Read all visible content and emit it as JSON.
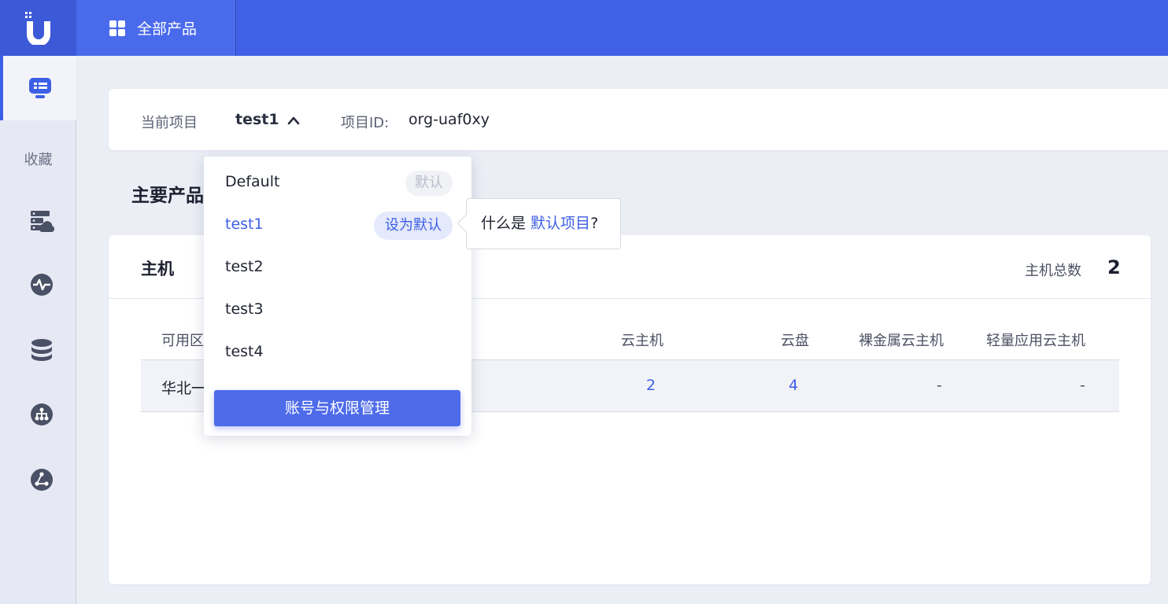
{
  "topbar": {
    "all_products_label": "全部产品"
  },
  "sidebar": {
    "favorites_label": "收藏",
    "items": [
      {
        "icon": "dashboard-icon"
      },
      {
        "icon": "cloud-server-icon"
      },
      {
        "icon": "monitoring-icon"
      },
      {
        "icon": "database-icon"
      },
      {
        "icon": "network-icon"
      },
      {
        "icon": "cloud-share-icon"
      }
    ]
  },
  "project_bar": {
    "current_project_label": "当前项目",
    "current_project": "test1",
    "project_id_label": "项目ID:",
    "project_id": "org-uaf0xy"
  },
  "main": {
    "section_title": "主要产品"
  },
  "host_card": {
    "title": "主机",
    "total_label": "主机总数",
    "total_value": "2",
    "columns": [
      "可用区",
      "云主机",
      "云盘",
      "裸金属云主机",
      "轻量应用云主机"
    ],
    "rows": [
      {
        "zone": "华北一",
        "cloud_hosts": "2",
        "disks": "4",
        "bare_metal": "-",
        "lightweight": "-"
      }
    ]
  },
  "project_dropdown": {
    "items": [
      {
        "name": "Default",
        "badge": "默认"
      },
      {
        "name": "test1",
        "action": "设为默认"
      },
      {
        "name": "test2"
      },
      {
        "name": "test3"
      },
      {
        "name": "test4"
      }
    ],
    "manage_button": "账号与权限管理"
  },
  "tooltip": {
    "prefix": "什么是 ",
    "link": "默认项目",
    "suffix": "?"
  },
  "colors": {
    "brand": "#4061e6",
    "accent": "#3d5fe5"
  }
}
